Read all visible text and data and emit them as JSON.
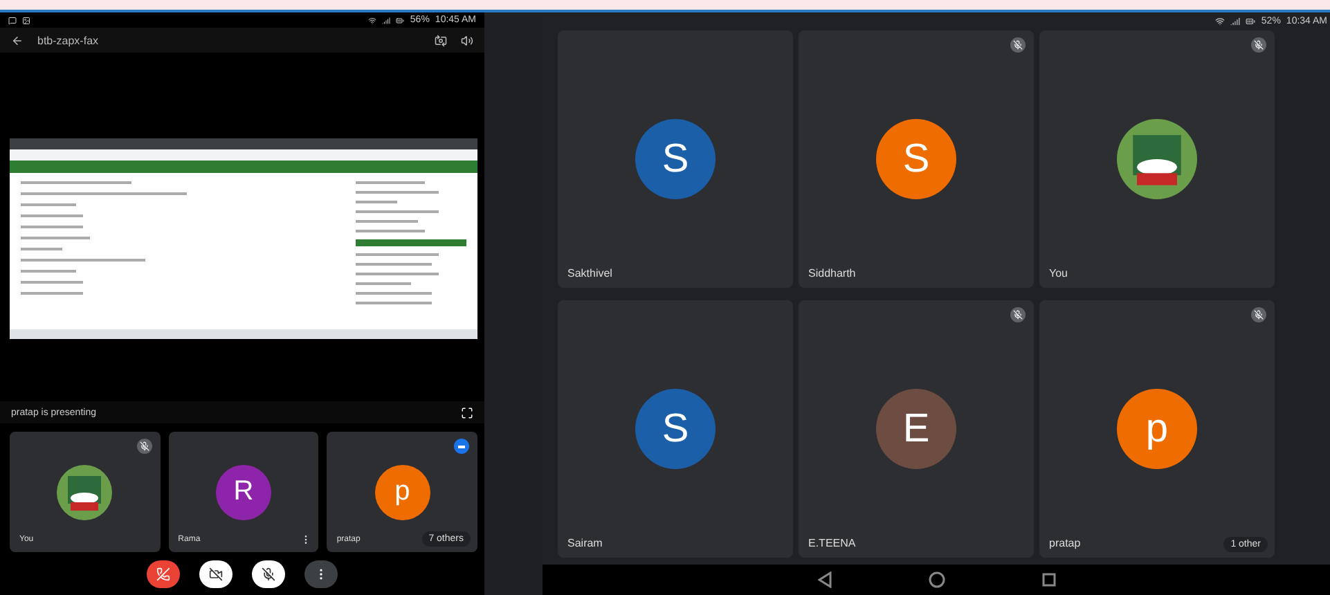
{
  "left_phone": {
    "status_bar": {
      "battery": "56%",
      "time": "10:45 AM"
    },
    "meeting_code": "btb-zapx-fax",
    "presenter_caption": "pratap is presenting",
    "tiles": [
      {
        "name": "You",
        "kind": "picture",
        "muted": true,
        "speaking": false,
        "menu": false
      },
      {
        "name": "Rama",
        "kind": "letter",
        "letter": "R",
        "color": "#8e24aa",
        "muted": false,
        "speaking": false,
        "menu": true
      },
      {
        "name": "pratap",
        "kind": "letter",
        "letter": "p",
        "color": "#ef6c00",
        "muted": false,
        "speaking": true,
        "menu": false,
        "others": "7 others"
      }
    ]
  },
  "right_phone": {
    "status_bar": {
      "battery": "52%",
      "time": "10:34 AM"
    },
    "tiles": [
      {
        "name": "Sakthivel",
        "kind": "letter",
        "letter": "S",
        "color": "#1a5fa8",
        "muted": false
      },
      {
        "name": "Siddharth",
        "kind": "letter",
        "letter": "S",
        "color": "#ef6c00",
        "muted": true
      },
      {
        "name": "You",
        "kind": "picture",
        "muted": true
      },
      {
        "name": "Sairam",
        "kind": "letter",
        "letter": "S",
        "color": "#1a5fa8",
        "muted": false
      },
      {
        "name": "E.TEENA",
        "kind": "letter",
        "letter": "E",
        "color": "#6d4c41",
        "muted": true
      },
      {
        "name": "pratap",
        "kind": "letter",
        "letter": "p",
        "color": "#ef6c00",
        "muted": true,
        "others": "1 other"
      }
    ]
  }
}
